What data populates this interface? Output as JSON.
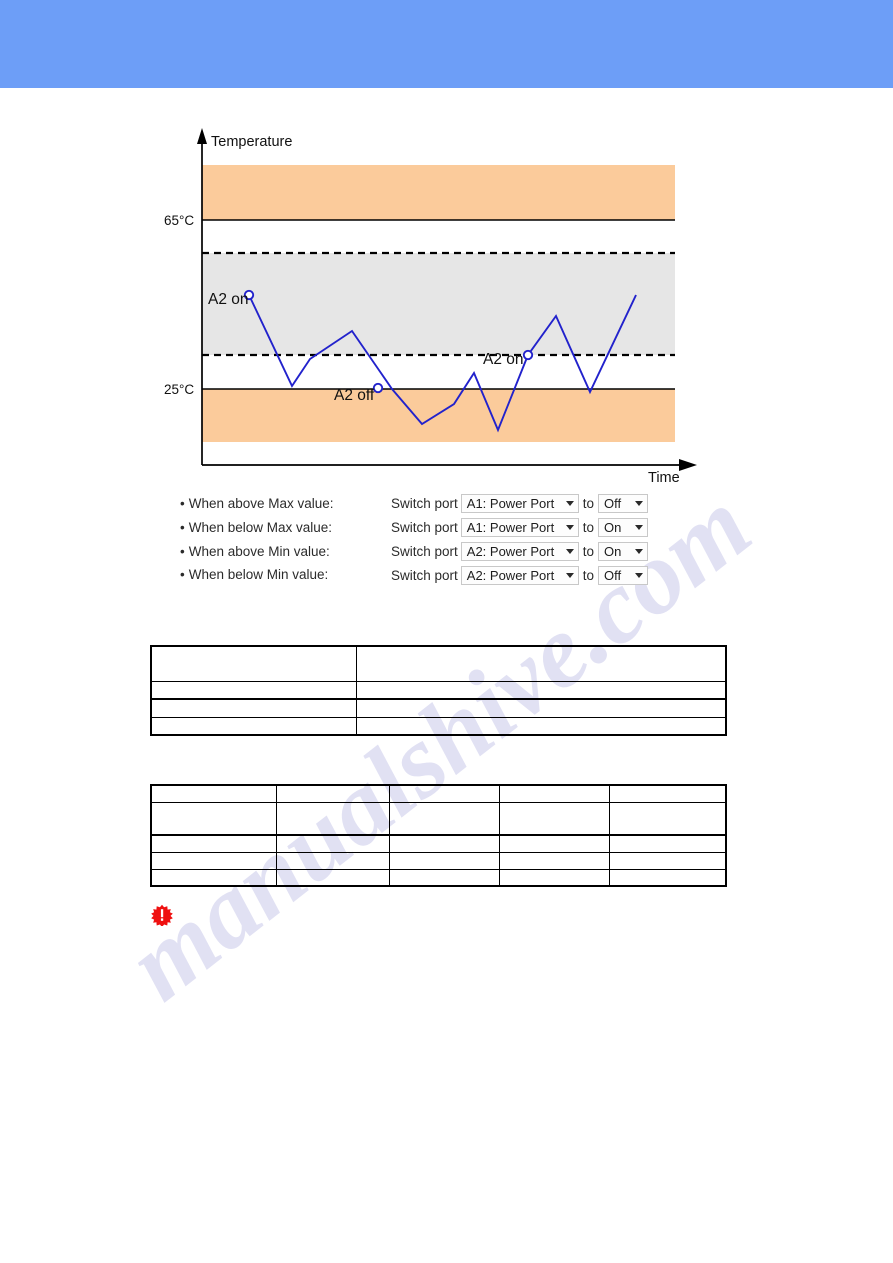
{
  "header": {
    "banner_color": "#6d9ef7"
  },
  "watermark": {
    "text": "manualshive.com",
    "color": "#c9c9ea"
  },
  "chart_data": {
    "type": "line",
    "title": "",
    "xlabel": "Time",
    "ylabel": "Temperature",
    "axis_labels": {
      "y_axis_title": "Temperature",
      "x_axis_title": "Time"
    },
    "y_ticks": [
      "65°C",
      "25°C"
    ],
    "y_tick_values": [
      65,
      25
    ],
    "ylim": [
      10,
      80
    ],
    "xlim": [
      0,
      100
    ],
    "grid": false,
    "legend": false,
    "bands": [
      {
        "name": "above-max-band",
        "color": "#fbcb9b",
        "y_from": 65,
        "y_to": 80
      },
      {
        "name": "hysteresis-band",
        "color": "#e6e6e6",
        "y_from": 36,
        "y_to": 58
      },
      {
        "name": "below-min-band",
        "color": "#fbcb9b",
        "y_from": 14,
        "y_to": 25
      }
    ],
    "solid_threshold_lines": [
      65,
      25
    ],
    "dashed_threshold_lines": [
      58,
      36
    ],
    "series": [
      {
        "name": "temperature",
        "color": "#2222cc",
        "x": [
          3,
          16,
          25,
          33,
          40,
          48,
          55,
          63,
          70,
          76,
          83,
          90,
          97
        ],
        "y": [
          49,
          30.5,
          38,
          45,
          25,
          18.5,
          24,
          30,
          17.5,
          36,
          47,
          29,
          50
        ]
      }
    ],
    "markers": [
      {
        "label": "A2 on",
        "x": 3,
        "y": 49,
        "label_position": "left"
      },
      {
        "label": "A2 off",
        "x": 40,
        "y": 25,
        "label_position": "below-left"
      },
      {
        "label": "A2 on",
        "x": 76,
        "y": 36,
        "label_position": "below-left"
      }
    ],
    "annotations": [
      "A2 on",
      "A2 off",
      "A2 on"
    ]
  },
  "rules": {
    "items": [
      {
        "bullet": "•",
        "label": "When above Max value:"
      },
      {
        "bullet": "•",
        "label": "When below Max value:"
      },
      {
        "bullet": "•",
        "label": "When above Min value:"
      },
      {
        "bullet": "•",
        "label": "When below Min value:"
      }
    ]
  },
  "actions": {
    "prefix_label": "Switch port",
    "connector_label": "to",
    "rows": [
      {
        "prefix": "Switch port",
        "port": "A1: Power Port",
        "connector": "to",
        "state": "Off"
      },
      {
        "prefix": "Switch port",
        "port": "A1: Power Port",
        "connector": "to",
        "state": "On"
      },
      {
        "prefix": "Switch port",
        "port": "A2: Power Port",
        "connector": "to",
        "state": "On"
      },
      {
        "prefix": "Switch port",
        "port": "A2: Power Port",
        "connector": "to",
        "state": "Off"
      }
    ]
  },
  "table_one": {
    "rows": [
      [
        "",
        ""
      ],
      [
        "",
        ""
      ],
      [
        "",
        ""
      ],
      [
        "",
        ""
      ]
    ]
  },
  "table_two": {
    "rows": [
      [
        "",
        "",
        "",
        "",
        ""
      ],
      [
        "",
        "",
        "",
        "",
        ""
      ],
      [
        "",
        "",
        "",
        "",
        ""
      ],
      [
        "",
        "",
        "",
        "",
        ""
      ],
      [
        "",
        "",
        "",
        "",
        ""
      ]
    ]
  },
  "note": {
    "icon": "warning-burst-icon",
    "color": "#ef1010"
  }
}
